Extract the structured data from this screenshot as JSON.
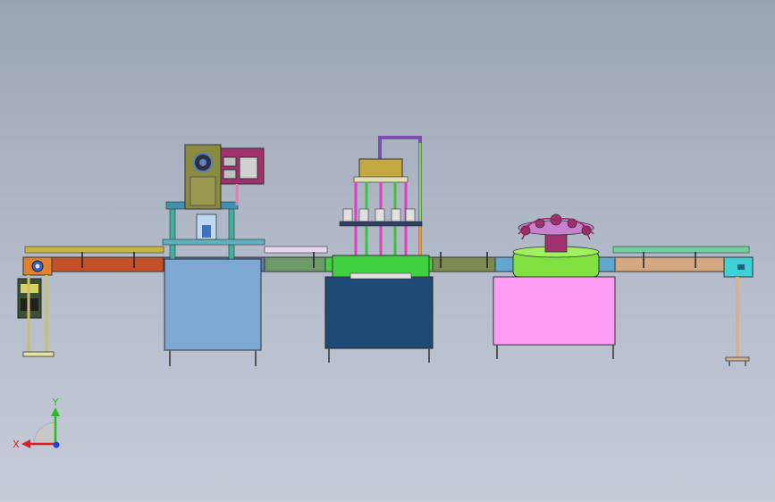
{
  "view": {
    "background_top": "#9aa5b4",
    "background_bottom": "#c6ccd8"
  },
  "triad": {
    "x_label": "X",
    "y_label": "Y",
    "x_color": "#e02020",
    "y_color": "#20c020",
    "z_color": "#2040e0"
  },
  "colors": {
    "conveyor_left": "#c4502a",
    "conveyor_mid": "#6e9a6a",
    "conveyor_right": "#d4a880",
    "rail_yellow": "#c8b440",
    "rail_green": "#6fd0a0",
    "rinser_cabinet": "#7ea8d4",
    "filler_cabinet": "#1f4a78",
    "capper_cabinet": "#ff9cf4",
    "capper_turret": "#80e040",
    "filler_tank": "#c4a840",
    "control_box": "#8a8a40",
    "pump": "#a0306e"
  }
}
